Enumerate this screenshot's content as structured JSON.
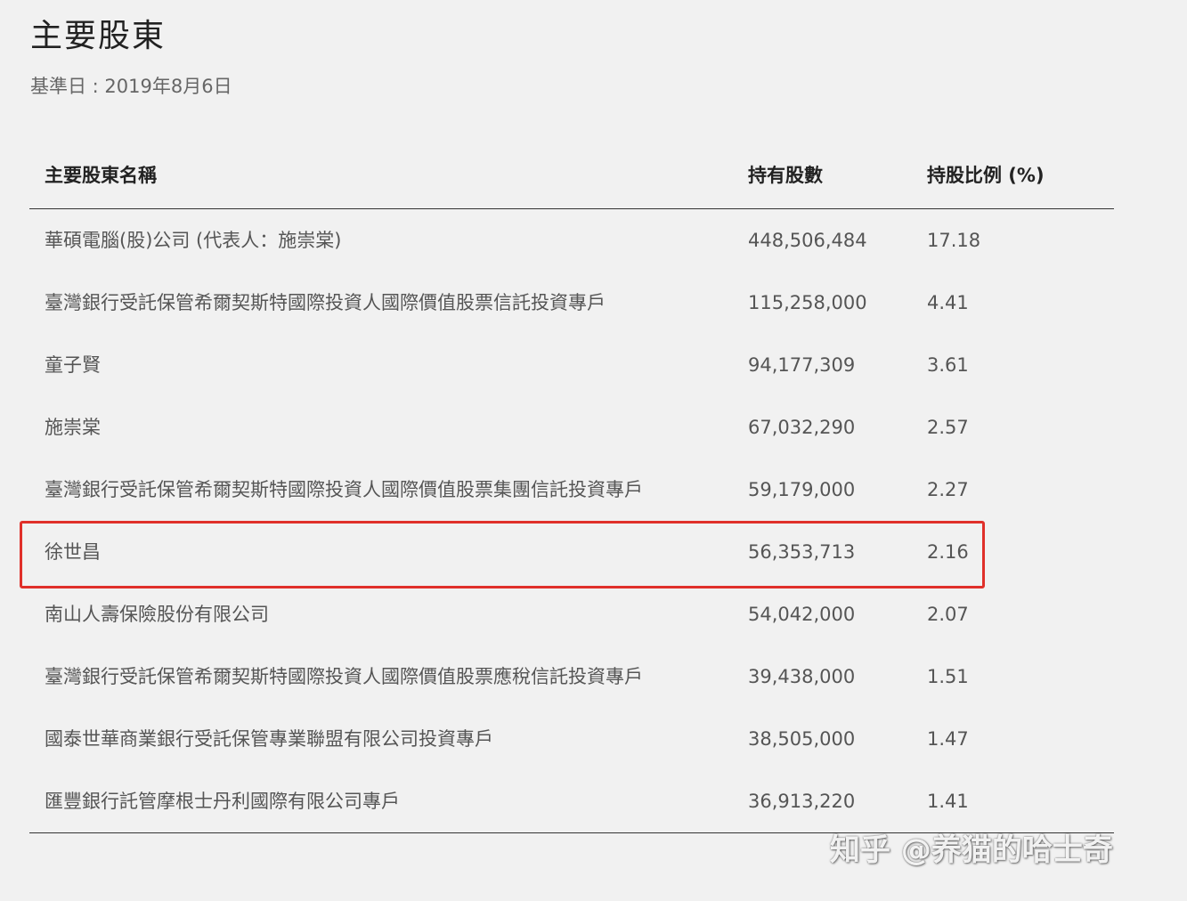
{
  "header": {
    "title": "主要股東",
    "date_label": "基準日 : 2019年8月6日"
  },
  "table": {
    "columns": [
      "主要股東名稱",
      "持有股數",
      "持股比例 (%)"
    ],
    "rows": [
      {
        "name": "華碩電腦(股)公司 (代表人：施崇棠)",
        "shares": "448,506,484",
        "pct": "17.18"
      },
      {
        "name": "臺灣銀行受託保管希爾契斯特國際投資人國際價值股票信託投資專戶",
        "shares": "115,258,000",
        "pct": "4.41"
      },
      {
        "name": "童子賢",
        "shares": "94,177,309",
        "pct": "3.61"
      },
      {
        "name": "施崇棠",
        "shares": "67,032,290",
        "pct": "2.57"
      },
      {
        "name": "臺灣銀行受託保管希爾契斯特國際投資人國際價值股票集團信託投資專戶",
        "shares": "59,179,000",
        "pct": "2.27"
      },
      {
        "name": "徐世昌",
        "shares": "56,353,713",
        "pct": "2.16"
      },
      {
        "name": "南山人壽保險股份有限公司",
        "shares": "54,042,000",
        "pct": "2.07"
      },
      {
        "name": "臺灣銀行受託保管希爾契斯特國際投資人國際價值股票應稅信託投資專戶",
        "shares": "39,438,000",
        "pct": "1.51"
      },
      {
        "name": "國泰世華商業銀行受託保管專業聯盟有限公司投資專戶",
        "shares": "38,505,000",
        "pct": "1.47"
      },
      {
        "name": "匯豐銀行託管摩根士丹利國際有限公司專戶",
        "shares": "36,913,220",
        "pct": "1.41"
      }
    ]
  },
  "watermark": "知乎 @养猫的哈士奇",
  "colors": {
    "background": "#f1f1f1",
    "highlight_border": "#e0302a"
  }
}
